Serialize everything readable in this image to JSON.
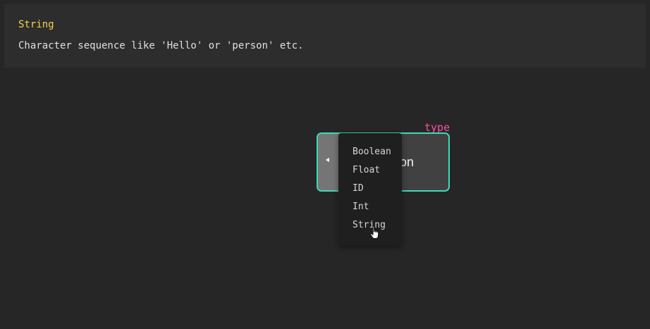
{
  "info": {
    "title": "String",
    "description": "Character sequence like 'Hello' or 'person' etc."
  },
  "node": {
    "type_label": "type",
    "value": "Person",
    "collapse_icon": "caret-left-icon"
  },
  "dropdown": {
    "options": [
      "Boolean",
      "Float",
      "ID",
      "Int",
      "String"
    ],
    "hovered": "String"
  },
  "cursor": {
    "icon": "hand-pointer-icon"
  },
  "colors": {
    "background": "#262626",
    "panel": "#2d2d2d",
    "title": "#f2d54a",
    "type_label": "#ff4fa3",
    "node_border": "#3fd9b6"
  }
}
